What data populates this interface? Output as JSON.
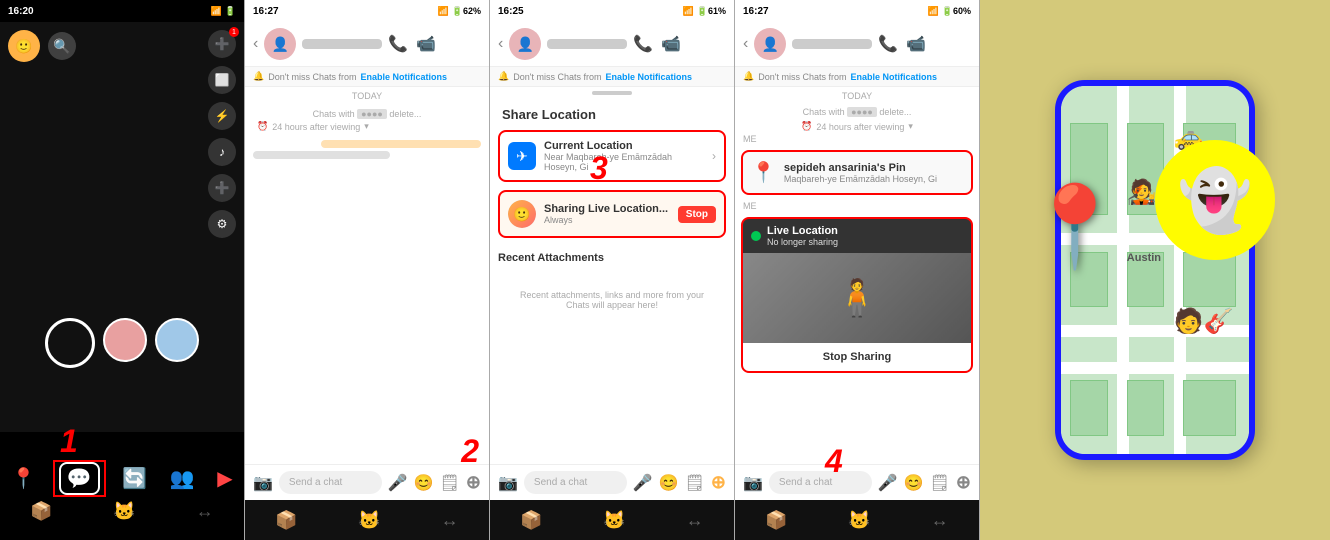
{
  "screens": [
    {
      "id": "screen1",
      "time": "16:20",
      "label": "1",
      "nav_items": [
        "📍",
        "💬",
        "🔄",
        "👥",
        "▶"
      ]
    },
    {
      "id": "screen2",
      "time": "16:27",
      "label": "2",
      "notification": "Don't miss Chats from",
      "enable_notif": "Enable Notifications",
      "today": "TODAY",
      "time_label": "24 hours after viewing",
      "send_chat": "Send a chat"
    },
    {
      "id": "screen3",
      "time": "16:25",
      "label": "3",
      "notification": "Don't miss Chats from",
      "enable_notif": "Enable Notifications",
      "share_location_title": "Share Location",
      "current_location_title": "Current Location",
      "current_location_sub": "Near Maqbareh-ye Emāmzādah Hoseyn, Gi",
      "live_location_title": "Sharing Live Location...",
      "live_location_sub": "Always",
      "stop_label": "Stop",
      "recent_attachments": "Recent Attachments",
      "recent_placeholder": "Recent attachments, links and more from your Chats will appear here!",
      "send_chat": "Send a chat"
    },
    {
      "id": "screen4",
      "time": "16:27",
      "label": "4",
      "notification": "Don't miss Chats from",
      "enable_notif": "Enable Notifications",
      "today": "TODAY",
      "time_label": "24 hours after viewing",
      "me_label1": "ME",
      "pin_title": "sepideh ansarinia's Pin",
      "pin_sub": "Maqbareh-ye Emāmzādah Hoseyn, Gi",
      "me_label2": "ME",
      "live_location_title": "Live Location",
      "live_location_sub": "No longer sharing",
      "stop_sharing": "Stop Sharing",
      "send_chat": "Send a chat"
    }
  ],
  "tutorial": {
    "map_label": "Austin",
    "snapchat_ghost": "👻"
  }
}
